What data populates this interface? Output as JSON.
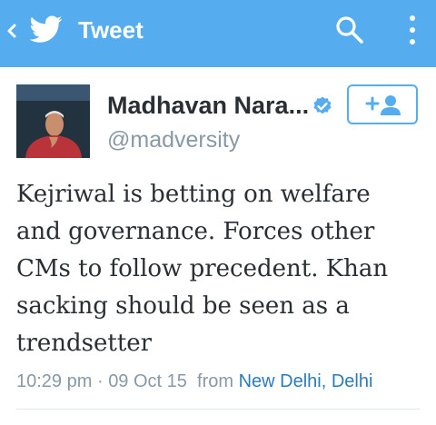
{
  "header": {
    "title": "Tweet",
    "back_icon": "chevron-left-icon",
    "logo_icon": "twitter-bird-icon",
    "search_icon": "search-icon",
    "menu_icon": "overflow-menu-icon",
    "background_color": "#55acee"
  },
  "author": {
    "display_name": "Madhavan Nara...",
    "handle": "@madversity",
    "verified": true,
    "verified_color": "#55acee",
    "follow_icon": "follow-user-icon"
  },
  "tweet": {
    "lines": [
      "Kejriwal is betting on welfare",
      "and governance. Forces other",
      "CMs to follow precedent. Khan",
      "sacking should be seen as a",
      "trendsetter"
    ],
    "time": "10:29 pm",
    "separator": "·",
    "date": "09 Oct 15",
    "from_label": "from",
    "location": "New Delhi, Delhi"
  },
  "colors": {
    "accent": "#55acee",
    "text": "#292f33",
    "muted": "#8899a6",
    "link": "#2b7bb9"
  }
}
